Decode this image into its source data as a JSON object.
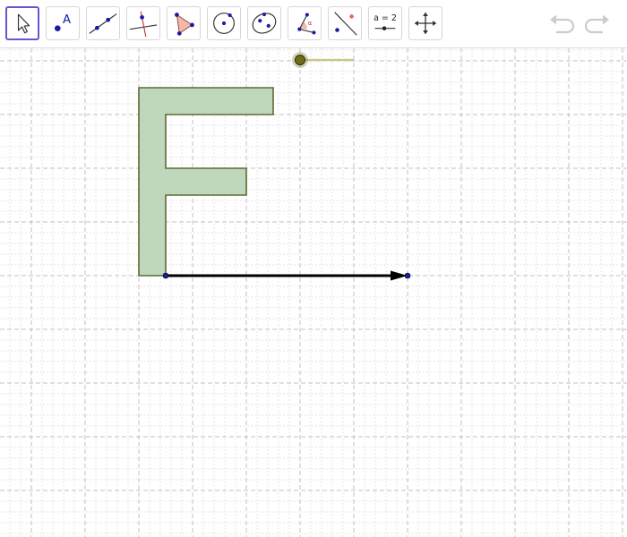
{
  "toolbar": {
    "tools": [
      {
        "id": "move",
        "icon": "move-cursor-icon",
        "selected": true
      },
      {
        "id": "point",
        "icon": "point-icon",
        "label": "A"
      },
      {
        "id": "line",
        "icon": "line-through-two-points-icon"
      },
      {
        "id": "perpendicular",
        "icon": "perpendicular-line-icon"
      },
      {
        "id": "polygon",
        "icon": "polygon-icon"
      },
      {
        "id": "circle",
        "icon": "circle-center-point-icon"
      },
      {
        "id": "ellipse",
        "icon": "ellipse-icon"
      },
      {
        "id": "angle",
        "icon": "angle-icon",
        "label": "α"
      },
      {
        "id": "reflect",
        "icon": "reflect-about-line-icon"
      },
      {
        "id": "slider",
        "icon": "slider-icon",
        "label": "a = 2"
      },
      {
        "id": "move-graphics",
        "icon": "move-graphics-view-icon"
      }
    ],
    "undo_icon": "undo-icon",
    "redo_icon": "redo-icon"
  },
  "colors": {
    "selected_border": "#6557d2",
    "shape_fill": "#bfd7bc",
    "shape_stroke": "#5c6b2e",
    "vector": "#000000",
    "point": "#1a1aa6",
    "slider_point": "#6e6e1a",
    "slider_track": "#c8c88a",
    "grid_major": "#c0c0c0",
    "grid_minor": "#e6e6e6",
    "disabled_icon": "#cccccc"
  }
}
